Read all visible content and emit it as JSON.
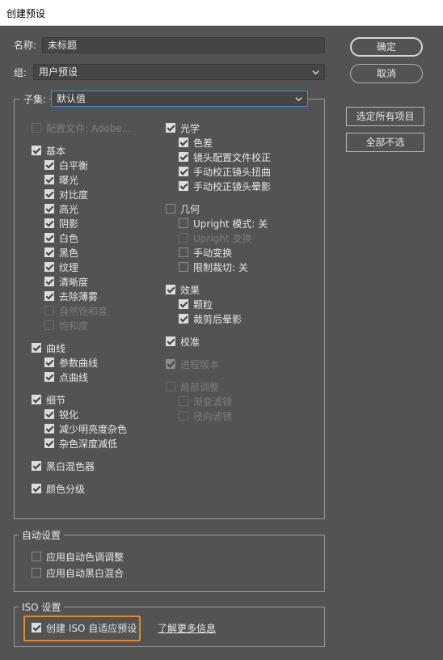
{
  "window": {
    "title": "创建预设"
  },
  "form": {
    "name_label": "名称:",
    "name_value": "未标题",
    "group_label": "组:",
    "group_value": "用户预设",
    "subset_label": "子集:",
    "subset_value": "默认值"
  },
  "buttons": {
    "ok": "确定",
    "cancel": "取消",
    "select_all": "选定所有项目",
    "select_none": "全部不选"
  },
  "settings": {
    "profile": "配置文件: Adobe...",
    "basic": "基本",
    "basic_items": [
      "白平衡",
      "曝光",
      "对比度",
      "高光",
      "阴影",
      "白色",
      "黑色",
      "纹理",
      "清晰度",
      "去除薄雾",
      "自然饱和度",
      "饱和度"
    ],
    "curves": "曲线",
    "curves_items": [
      "参数曲线",
      "点曲线"
    ],
    "detail": "细节",
    "detail_items": [
      "锐化",
      "减少明亮度杂色",
      "杂色深度减低"
    ],
    "bw_mixer": "黑白混色器",
    "color_grading": "颜色分级",
    "optics": "光学",
    "optics_items": [
      "色差",
      "镜头配置文件校正",
      "手动校正镜头扭曲",
      "手动校正镜头晕影"
    ],
    "geometry": "几何",
    "geometry_items": [
      "Upright 模式: 关",
      "Upright 变换",
      "手动变换",
      "限制裁切: 关"
    ],
    "effects": "效果",
    "effects_items": [
      "颗粒",
      "裁剪后晕影"
    ],
    "calibration": "校准",
    "process_version": "进程版本",
    "local_adjustments": "局部调整",
    "local_items": [
      "渐变滤镜",
      "径向滤镜"
    ]
  },
  "auto": {
    "legend": "自动设置",
    "auto_tone": "应用自动色调调整",
    "auto_bw": "应用自动黑白混合"
  },
  "iso": {
    "legend": "ISO 设置",
    "create_iso": "创建 ISO 自适应预设",
    "learn_more": "了解更多信息"
  },
  "colors": {
    "background": "#535353",
    "highlight": "#e8862a",
    "focus": "#4a90d9"
  }
}
